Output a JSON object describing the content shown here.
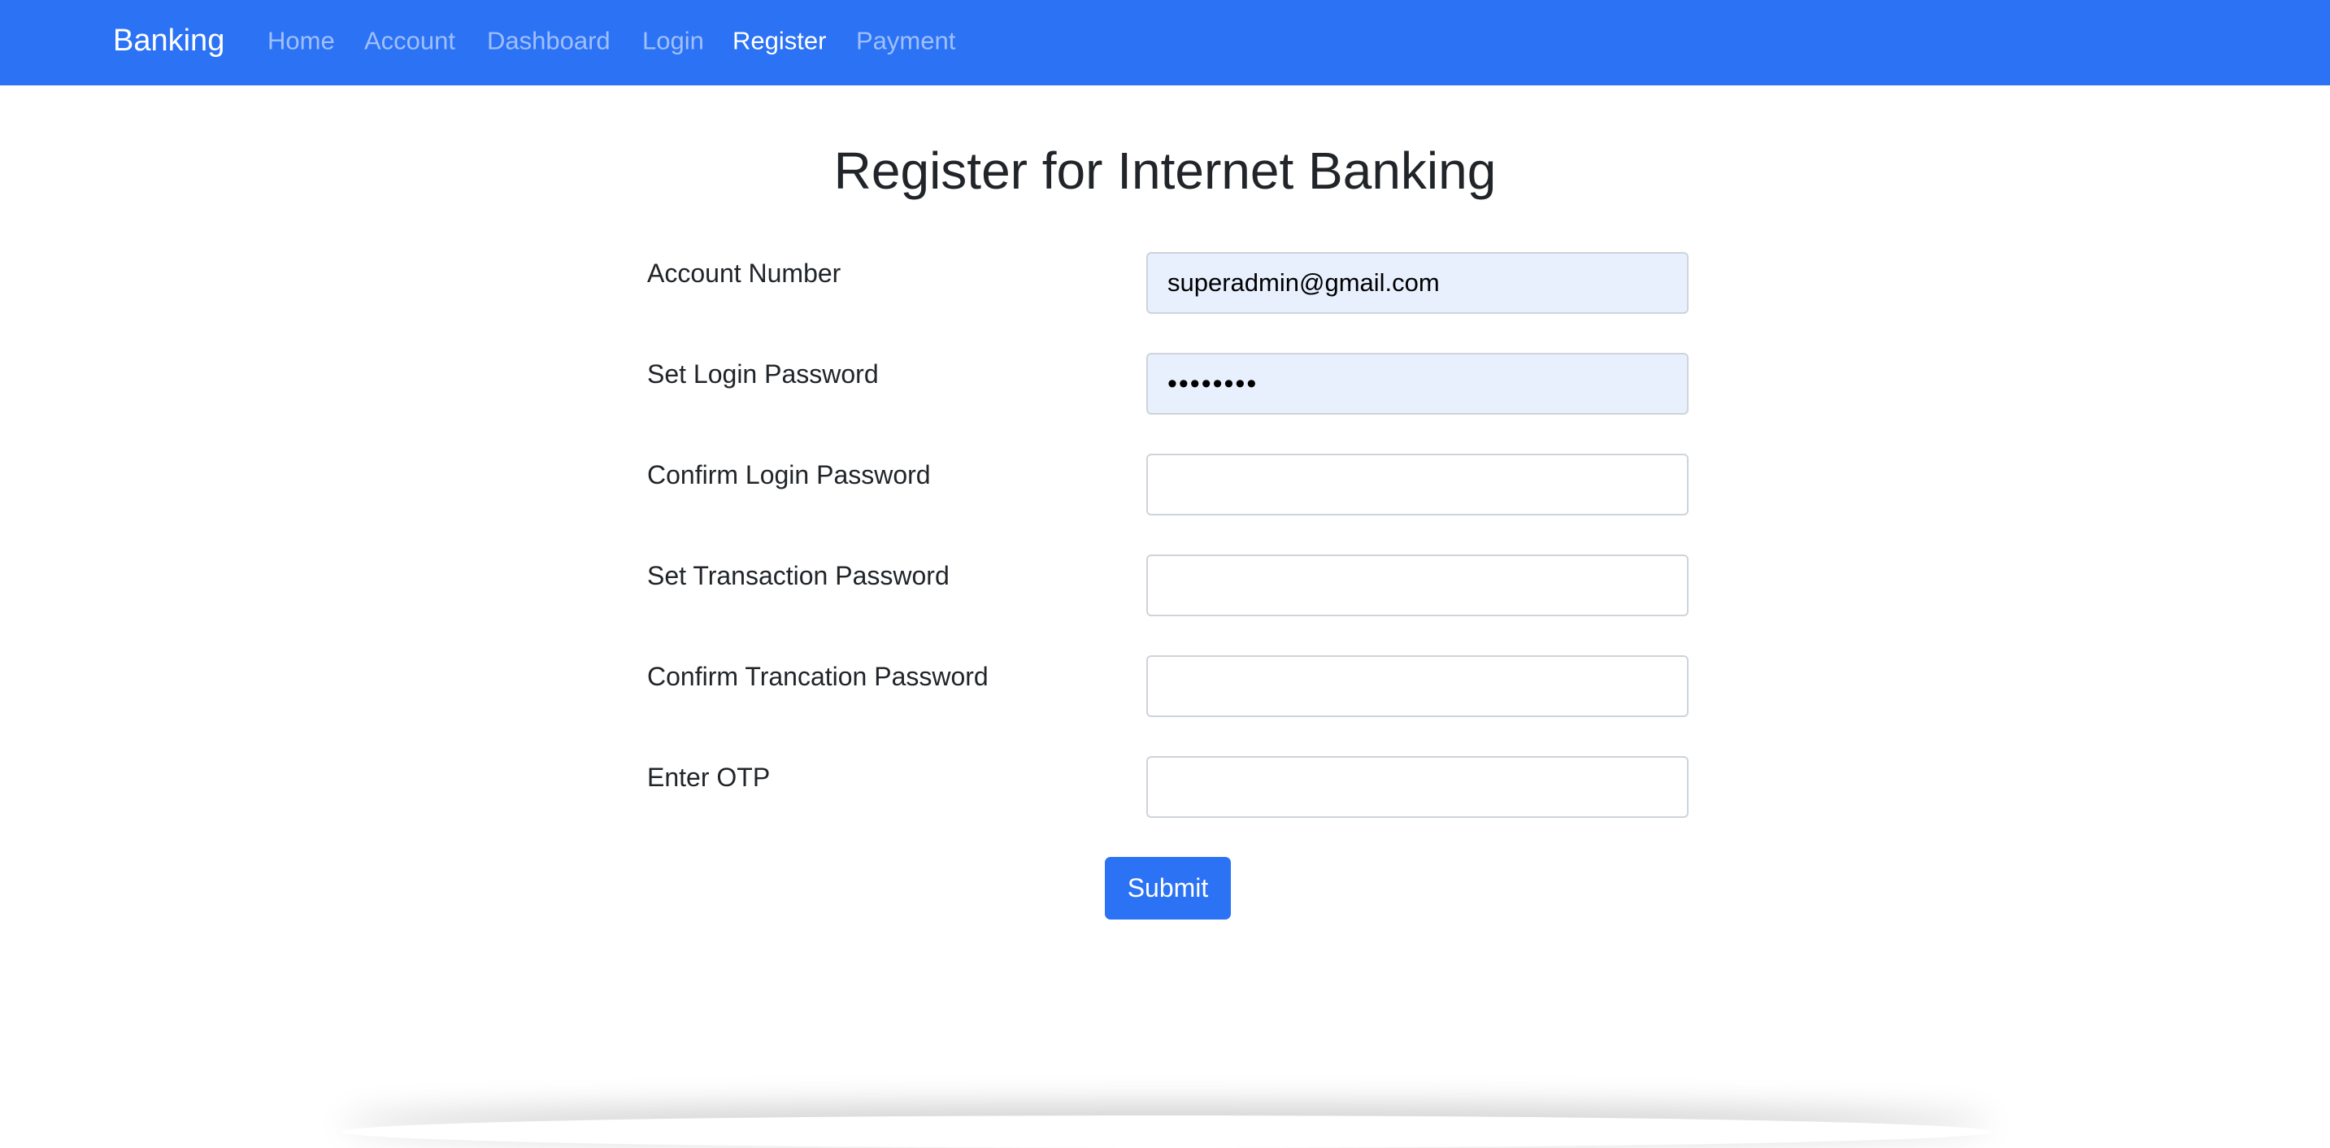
{
  "navbar": {
    "brand": "Banking",
    "items": [
      {
        "label": "Home",
        "active": false
      },
      {
        "label": "Account",
        "active": false
      },
      {
        "label": "Dashboard",
        "active": false
      },
      {
        "label": "Login",
        "active": false
      },
      {
        "label": "Register",
        "active": true
      },
      {
        "label": "Payment",
        "active": false
      }
    ]
  },
  "page": {
    "title": "Register for Internet Banking"
  },
  "form": {
    "fields": [
      {
        "label": "Account Number",
        "value": "superadmin@gmail.com",
        "placeholder": ""
      },
      {
        "label": "Set Login Password",
        "value": "••••••••",
        "placeholder": ""
      },
      {
        "label": "Confirm Login Password",
        "value": "",
        "placeholder": ""
      },
      {
        "label": "Set Transaction Password",
        "value": "",
        "placeholder": ""
      },
      {
        "label": "Confirm Trancation Password",
        "value": "",
        "placeholder": ""
      },
      {
        "label": "Enter OTP",
        "value": "",
        "placeholder": ""
      }
    ],
    "submit_label": "Submit"
  },
  "colors": {
    "navbar_bg": "#2b72f5",
    "button_bg": "#2b72f5",
    "autofill_bg": "#e8f0fe"
  }
}
